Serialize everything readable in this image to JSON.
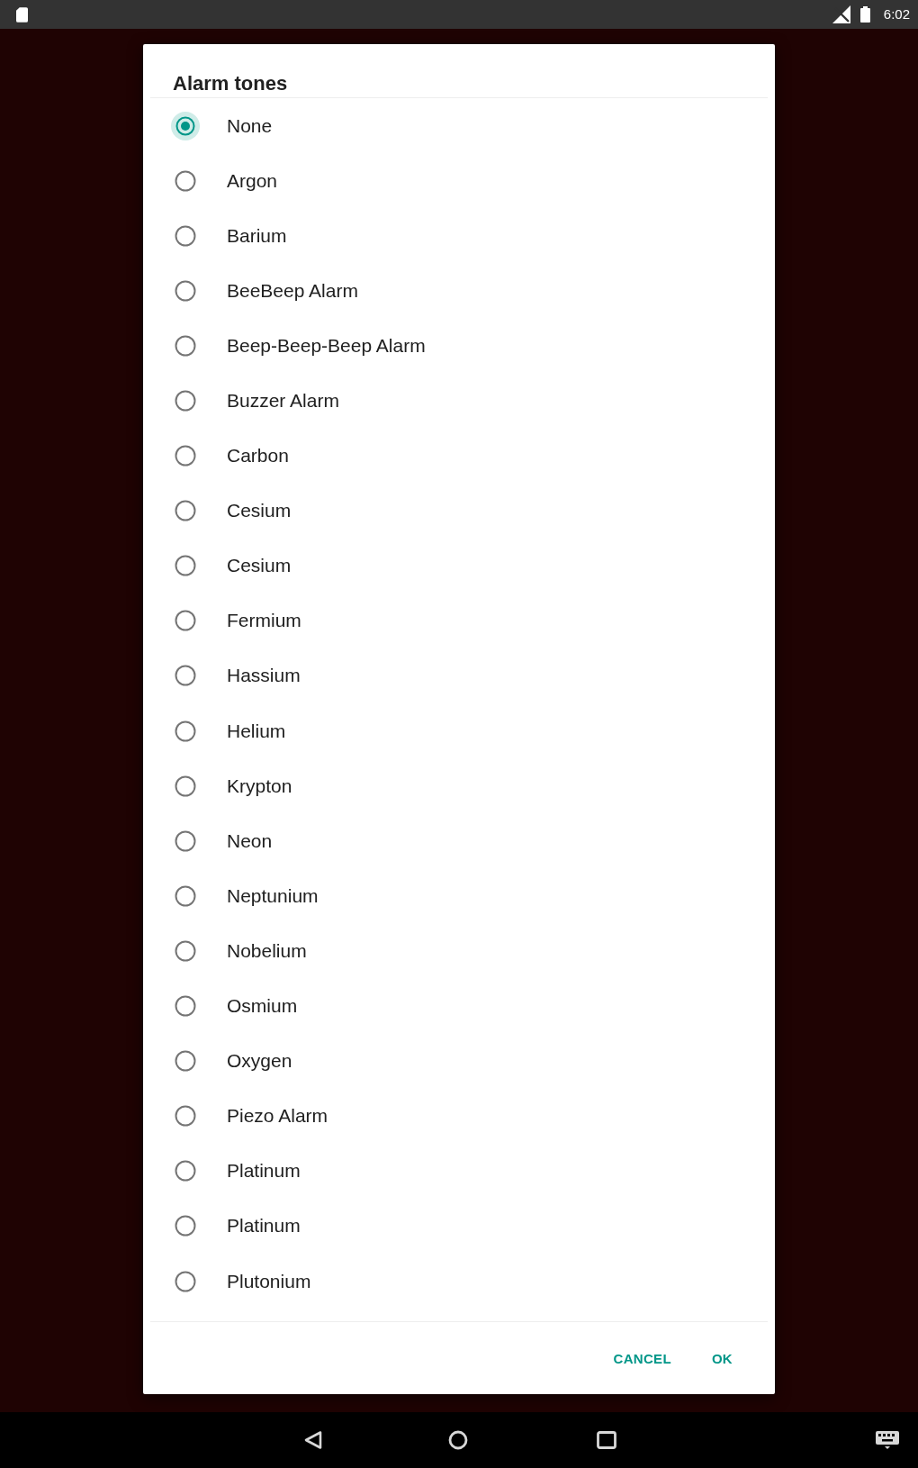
{
  "status_bar": {
    "time": "6:02"
  },
  "dialog": {
    "title": "Alarm tones",
    "options": [
      {
        "label": "None",
        "selected": true
      },
      {
        "label": "Argon",
        "selected": false
      },
      {
        "label": "Barium",
        "selected": false
      },
      {
        "label": "BeeBeep Alarm",
        "selected": false
      },
      {
        "label": "Beep-Beep-Beep Alarm",
        "selected": false
      },
      {
        "label": "Buzzer Alarm",
        "selected": false
      },
      {
        "label": "Carbon",
        "selected": false
      },
      {
        "label": "Cesium",
        "selected": false
      },
      {
        "label": "Cesium",
        "selected": false
      },
      {
        "label": "Fermium",
        "selected": false
      },
      {
        "label": "Hassium",
        "selected": false
      },
      {
        "label": "Helium",
        "selected": false
      },
      {
        "label": "Krypton",
        "selected": false
      },
      {
        "label": "Neon",
        "selected": false
      },
      {
        "label": "Neptunium",
        "selected": false
      },
      {
        "label": "Nobelium",
        "selected": false
      },
      {
        "label": "Osmium",
        "selected": false
      },
      {
        "label": "Oxygen",
        "selected": false
      },
      {
        "label": "Piezo Alarm",
        "selected": false
      },
      {
        "label": "Platinum",
        "selected": false
      },
      {
        "label": "Platinum",
        "selected": false
      },
      {
        "label": "Plutonium",
        "selected": false
      }
    ],
    "buttons": [
      "CANCEL",
      "OK"
    ]
  }
}
